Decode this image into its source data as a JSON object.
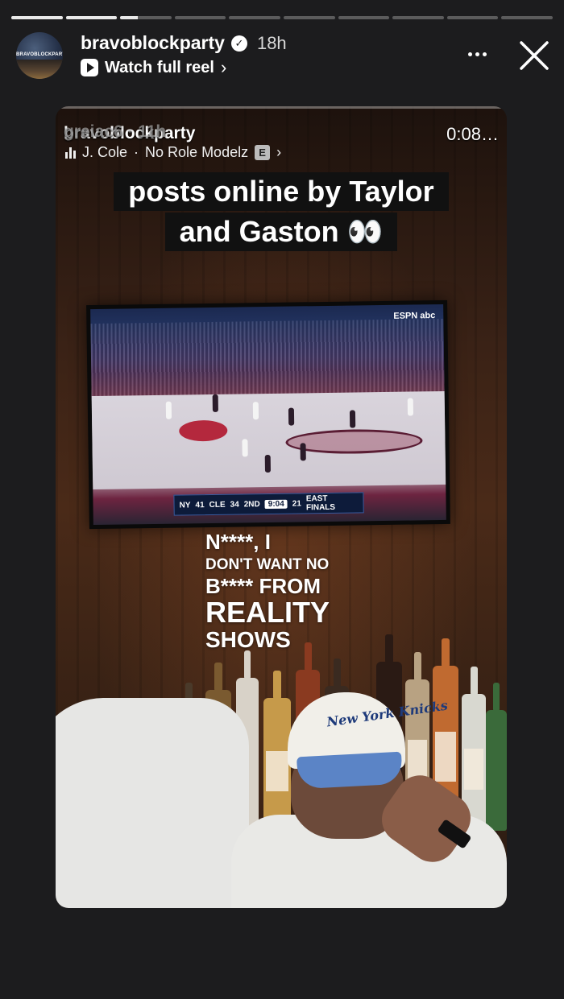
{
  "story": {
    "username": "bravoblockparty",
    "verified": true,
    "posted_ago": "18h",
    "watch_reel_label": "Watch full reel",
    "avatar_text": "BRAVOBLOCKPARTY",
    "progress": {
      "segments": 10,
      "current_index": 2,
      "current_fill": 0.35
    }
  },
  "reel": {
    "original_user_ghost": "greiac6 · 11h",
    "overlay_username": "bravoblockparty",
    "duration": "0:08",
    "music": {
      "artist": "J. Cole",
      "song": "No Role Modelz",
      "explicit_label": "E"
    },
    "caption_lines": [
      "posts online by Taylor",
      "and Gaston 👀"
    ],
    "lyrics": [
      "N****, I",
      "DON'T WANT NO",
      "B**** FROM",
      "REALITY",
      "SHOWS"
    ],
    "tv": {
      "network": "ESPN abc",
      "score": {
        "team1": "NY",
        "score1": "41",
        "team2": "CLE",
        "score2": "34",
        "quarter": "2ND",
        "clock": "9:04",
        "shot_clock": "21",
        "series": "EAST FINALS"
      }
    },
    "cap_text": "New York Knicks"
  },
  "colors": {
    "background": "#1c1c1e",
    "progress_fill": "#e9e9e9",
    "caption_bg": "#111111"
  }
}
